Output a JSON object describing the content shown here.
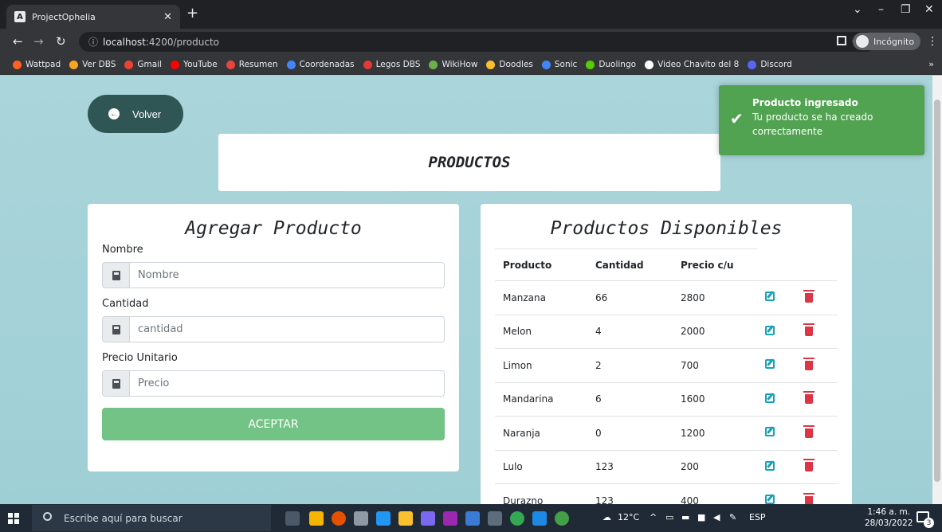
{
  "browser": {
    "tab_title": "ProjectOphelia",
    "tab_favicon": "A",
    "address_host": "localhost",
    "address_path": ":4200/producto",
    "incognito_label": "Incógnito",
    "bookmarks": [
      {
        "label": "Wattpad",
        "color": "#ff6122"
      },
      {
        "label": "Ver DBS",
        "color": "#f5a623"
      },
      {
        "label": "Gmail",
        "color": "#ea4335"
      },
      {
        "label": "YouTube",
        "color": "#ff0000"
      },
      {
        "label": "Resumen",
        "color": "#e8453c"
      },
      {
        "label": "Coordenadas",
        "color": "#4285f4"
      },
      {
        "label": "Legos DBS",
        "color": "#e53935"
      },
      {
        "label": "WikiHow",
        "color": "#6ab04c"
      },
      {
        "label": "Doodles",
        "color": "#fbc02d"
      },
      {
        "label": "Sonic",
        "color": "#4285f4"
      },
      {
        "label": "Duolingo",
        "color": "#58cc02"
      },
      {
        "label": "Video Chavito del 8",
        "color": "#ffffff"
      },
      {
        "label": "Discord",
        "color": "#5865f2"
      }
    ]
  },
  "page": {
    "back_label": "Volver",
    "title": "PRODUCTOS",
    "toast": {
      "title": "Producto ingresado",
      "message": "Tu producto se ha creado correctamente"
    },
    "form": {
      "heading": "Agregar Producto",
      "name_label": "Nombre",
      "name_placeholder": "Nombre",
      "quantity_label": "Cantidad",
      "quantity_placeholder": "cantidad",
      "price_label": "Precio Unitario",
      "price_placeholder": "Precio",
      "submit_label": "ACEPTAR"
    },
    "list": {
      "heading": "Productos Disponibles",
      "columns": [
        "Producto",
        "Cantidad",
        "Precio c/u"
      ],
      "rows": [
        [
          "Manzana",
          "66",
          "2800"
        ],
        [
          "Melon",
          "4",
          "2000"
        ],
        [
          "Limon",
          "2",
          "700"
        ],
        [
          "Mandarina",
          "6",
          "1600"
        ],
        [
          "Naranja",
          "0",
          "1200"
        ],
        [
          "Lulo",
          "123",
          "200"
        ],
        [
          "Durazno",
          "123",
          "400"
        ]
      ]
    }
  },
  "taskbar": {
    "search_placeholder": "Escribe aquí para buscar",
    "weather": "12°C",
    "language": "ESP",
    "time": "1:46 a. m.",
    "date": "28/03/2022",
    "notification_count": "3"
  }
}
